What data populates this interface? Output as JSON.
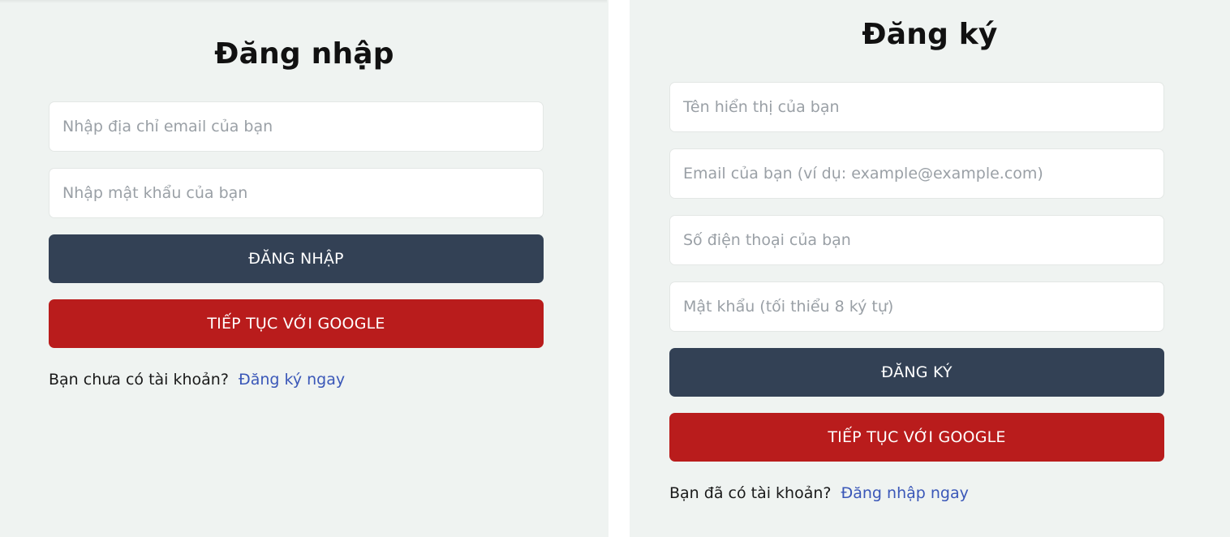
{
  "login": {
    "title": "Đăng nhập",
    "email_placeholder": "Nhập địa chỉ email của bạn",
    "password_placeholder": "Nhập mật khẩu của bạn",
    "submit_label": "ĐĂNG NHẬP",
    "google_label": "TIẾP TỤC VỚI GOOGLE",
    "footer_text": "Bạn chưa có tài khoản?",
    "footer_link": "Đăng ký ngay"
  },
  "register": {
    "title": "Đăng ký",
    "name_placeholder": "Tên hiển thị của bạn",
    "email_placeholder": "Email của bạn (ví dụ: example@example.com)",
    "phone_placeholder": "Số điện thoại của bạn",
    "password_placeholder": "Mật khẩu (tối thiểu 8 ký tự)",
    "submit_label": "ĐĂNG KÝ",
    "google_label": "TIẾP TỤC VỚI GOOGLE",
    "footer_text": "Bạn đã có tài khoản?",
    "footer_link": "Đăng nhập ngay"
  },
  "colors": {
    "panel_bg": "#eff3f1",
    "primary_button": "#334155",
    "google_button": "#b91c1c",
    "link": "#3a57b8"
  }
}
